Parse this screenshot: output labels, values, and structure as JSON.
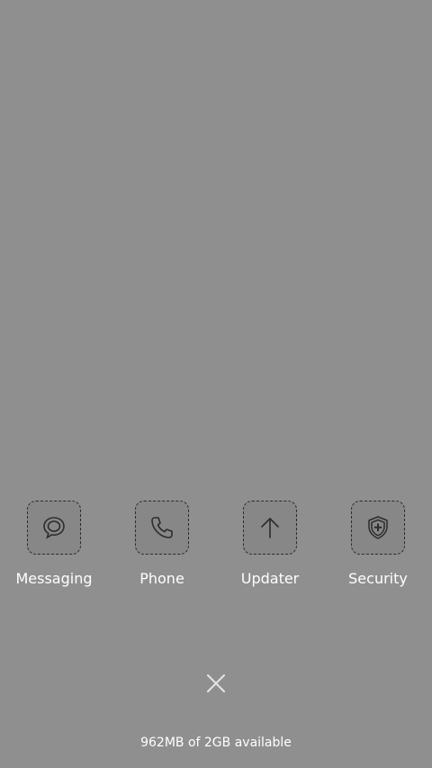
{
  "apps": [
    {
      "label": "Messaging",
      "icon": "speech-bubble-icon"
    },
    {
      "label": "Phone",
      "icon": "phone-icon"
    },
    {
      "label": "Updater",
      "icon": "arrow-up-icon"
    },
    {
      "label": "Security",
      "icon": "shield-plus-icon"
    }
  ],
  "close_icon": "close-icon",
  "memory_status": "962MB of 2GB available",
  "colors": {
    "background": "#8f8f8f",
    "icon_stroke": "#2c2c2c",
    "text": "#ffffff",
    "close": "#e6e6e6"
  }
}
